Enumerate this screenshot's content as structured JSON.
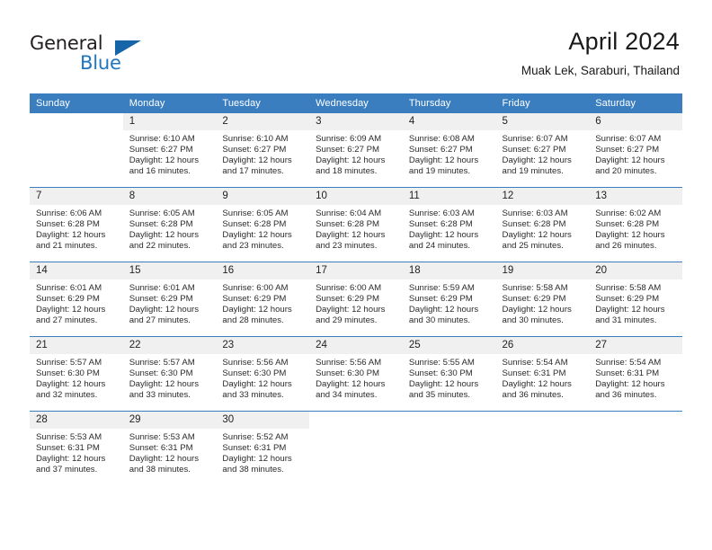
{
  "brand": {
    "name_part1": "General",
    "name_part2": "Blue",
    "triangle_color": "#1565a8",
    "blue_color": "#2077c0"
  },
  "header": {
    "title": "April 2024",
    "subtitle": "Muak Lek, Saraburi, Thailand"
  },
  "theme": {
    "header_row_bg": "#3a7ebf",
    "daynum_bg": "#f0f0f0",
    "grid_line": "#3a7ebf",
    "text": "#222222"
  },
  "weekday_headers": [
    "Sunday",
    "Monday",
    "Tuesday",
    "Wednesday",
    "Thursday",
    "Friday",
    "Saturday"
  ],
  "weeks": [
    [
      {
        "day": "",
        "sunrise": "",
        "sunset": "",
        "daylight1": "",
        "daylight2": "",
        "blank": true
      },
      {
        "day": "1",
        "sunrise": "Sunrise: 6:10 AM",
        "sunset": "Sunset: 6:27 PM",
        "daylight1": "Daylight: 12 hours",
        "daylight2": "and 16 minutes."
      },
      {
        "day": "2",
        "sunrise": "Sunrise: 6:10 AM",
        "sunset": "Sunset: 6:27 PM",
        "daylight1": "Daylight: 12 hours",
        "daylight2": "and 17 minutes."
      },
      {
        "day": "3",
        "sunrise": "Sunrise: 6:09 AM",
        "sunset": "Sunset: 6:27 PM",
        "daylight1": "Daylight: 12 hours",
        "daylight2": "and 18 minutes."
      },
      {
        "day": "4",
        "sunrise": "Sunrise: 6:08 AM",
        "sunset": "Sunset: 6:27 PM",
        "daylight1": "Daylight: 12 hours",
        "daylight2": "and 19 minutes."
      },
      {
        "day": "5",
        "sunrise": "Sunrise: 6:07 AM",
        "sunset": "Sunset: 6:27 PM",
        "daylight1": "Daylight: 12 hours",
        "daylight2": "and 19 minutes."
      },
      {
        "day": "6",
        "sunrise": "Sunrise: 6:07 AM",
        "sunset": "Sunset: 6:27 PM",
        "daylight1": "Daylight: 12 hours",
        "daylight2": "and 20 minutes."
      }
    ],
    [
      {
        "day": "7",
        "sunrise": "Sunrise: 6:06 AM",
        "sunset": "Sunset: 6:28 PM",
        "daylight1": "Daylight: 12 hours",
        "daylight2": "and 21 minutes."
      },
      {
        "day": "8",
        "sunrise": "Sunrise: 6:05 AM",
        "sunset": "Sunset: 6:28 PM",
        "daylight1": "Daylight: 12 hours",
        "daylight2": "and 22 minutes."
      },
      {
        "day": "9",
        "sunrise": "Sunrise: 6:05 AM",
        "sunset": "Sunset: 6:28 PM",
        "daylight1": "Daylight: 12 hours",
        "daylight2": "and 23 minutes."
      },
      {
        "day": "10",
        "sunrise": "Sunrise: 6:04 AM",
        "sunset": "Sunset: 6:28 PM",
        "daylight1": "Daylight: 12 hours",
        "daylight2": "and 23 minutes."
      },
      {
        "day": "11",
        "sunrise": "Sunrise: 6:03 AM",
        "sunset": "Sunset: 6:28 PM",
        "daylight1": "Daylight: 12 hours",
        "daylight2": "and 24 minutes."
      },
      {
        "day": "12",
        "sunrise": "Sunrise: 6:03 AM",
        "sunset": "Sunset: 6:28 PM",
        "daylight1": "Daylight: 12 hours",
        "daylight2": "and 25 minutes."
      },
      {
        "day": "13",
        "sunrise": "Sunrise: 6:02 AM",
        "sunset": "Sunset: 6:28 PM",
        "daylight1": "Daylight: 12 hours",
        "daylight2": "and 26 minutes."
      }
    ],
    [
      {
        "day": "14",
        "sunrise": "Sunrise: 6:01 AM",
        "sunset": "Sunset: 6:29 PM",
        "daylight1": "Daylight: 12 hours",
        "daylight2": "and 27 minutes."
      },
      {
        "day": "15",
        "sunrise": "Sunrise: 6:01 AM",
        "sunset": "Sunset: 6:29 PM",
        "daylight1": "Daylight: 12 hours",
        "daylight2": "and 27 minutes."
      },
      {
        "day": "16",
        "sunrise": "Sunrise: 6:00 AM",
        "sunset": "Sunset: 6:29 PM",
        "daylight1": "Daylight: 12 hours",
        "daylight2": "and 28 minutes."
      },
      {
        "day": "17",
        "sunrise": "Sunrise: 6:00 AM",
        "sunset": "Sunset: 6:29 PM",
        "daylight1": "Daylight: 12 hours",
        "daylight2": "and 29 minutes."
      },
      {
        "day": "18",
        "sunrise": "Sunrise: 5:59 AM",
        "sunset": "Sunset: 6:29 PM",
        "daylight1": "Daylight: 12 hours",
        "daylight2": "and 30 minutes."
      },
      {
        "day": "19",
        "sunrise": "Sunrise: 5:58 AM",
        "sunset": "Sunset: 6:29 PM",
        "daylight1": "Daylight: 12 hours",
        "daylight2": "and 30 minutes."
      },
      {
        "day": "20",
        "sunrise": "Sunrise: 5:58 AM",
        "sunset": "Sunset: 6:29 PM",
        "daylight1": "Daylight: 12 hours",
        "daylight2": "and 31 minutes."
      }
    ],
    [
      {
        "day": "21",
        "sunrise": "Sunrise: 5:57 AM",
        "sunset": "Sunset: 6:30 PM",
        "daylight1": "Daylight: 12 hours",
        "daylight2": "and 32 minutes."
      },
      {
        "day": "22",
        "sunrise": "Sunrise: 5:57 AM",
        "sunset": "Sunset: 6:30 PM",
        "daylight1": "Daylight: 12 hours",
        "daylight2": "and 33 minutes."
      },
      {
        "day": "23",
        "sunrise": "Sunrise: 5:56 AM",
        "sunset": "Sunset: 6:30 PM",
        "daylight1": "Daylight: 12 hours",
        "daylight2": "and 33 minutes."
      },
      {
        "day": "24",
        "sunrise": "Sunrise: 5:56 AM",
        "sunset": "Sunset: 6:30 PM",
        "daylight1": "Daylight: 12 hours",
        "daylight2": "and 34 minutes."
      },
      {
        "day": "25",
        "sunrise": "Sunrise: 5:55 AM",
        "sunset": "Sunset: 6:30 PM",
        "daylight1": "Daylight: 12 hours",
        "daylight2": "and 35 minutes."
      },
      {
        "day": "26",
        "sunrise": "Sunrise: 5:54 AM",
        "sunset": "Sunset: 6:31 PM",
        "daylight1": "Daylight: 12 hours",
        "daylight2": "and 36 minutes."
      },
      {
        "day": "27",
        "sunrise": "Sunrise: 5:54 AM",
        "sunset": "Sunset: 6:31 PM",
        "daylight1": "Daylight: 12 hours",
        "daylight2": "and 36 minutes."
      }
    ],
    [
      {
        "day": "28",
        "sunrise": "Sunrise: 5:53 AM",
        "sunset": "Sunset: 6:31 PM",
        "daylight1": "Daylight: 12 hours",
        "daylight2": "and 37 minutes."
      },
      {
        "day": "29",
        "sunrise": "Sunrise: 5:53 AM",
        "sunset": "Sunset: 6:31 PM",
        "daylight1": "Daylight: 12 hours",
        "daylight2": "and 38 minutes."
      },
      {
        "day": "30",
        "sunrise": "Sunrise: 5:52 AM",
        "sunset": "Sunset: 6:31 PM",
        "daylight1": "Daylight: 12 hours",
        "daylight2": "and 38 minutes."
      },
      {
        "day": "",
        "sunrise": "",
        "sunset": "",
        "daylight1": "",
        "daylight2": "",
        "blank": true
      },
      {
        "day": "",
        "sunrise": "",
        "sunset": "",
        "daylight1": "",
        "daylight2": "",
        "blank": true
      },
      {
        "day": "",
        "sunrise": "",
        "sunset": "",
        "daylight1": "",
        "daylight2": "",
        "blank": true
      },
      {
        "day": "",
        "sunrise": "",
        "sunset": "",
        "daylight1": "",
        "daylight2": "",
        "blank": true
      }
    ]
  ]
}
